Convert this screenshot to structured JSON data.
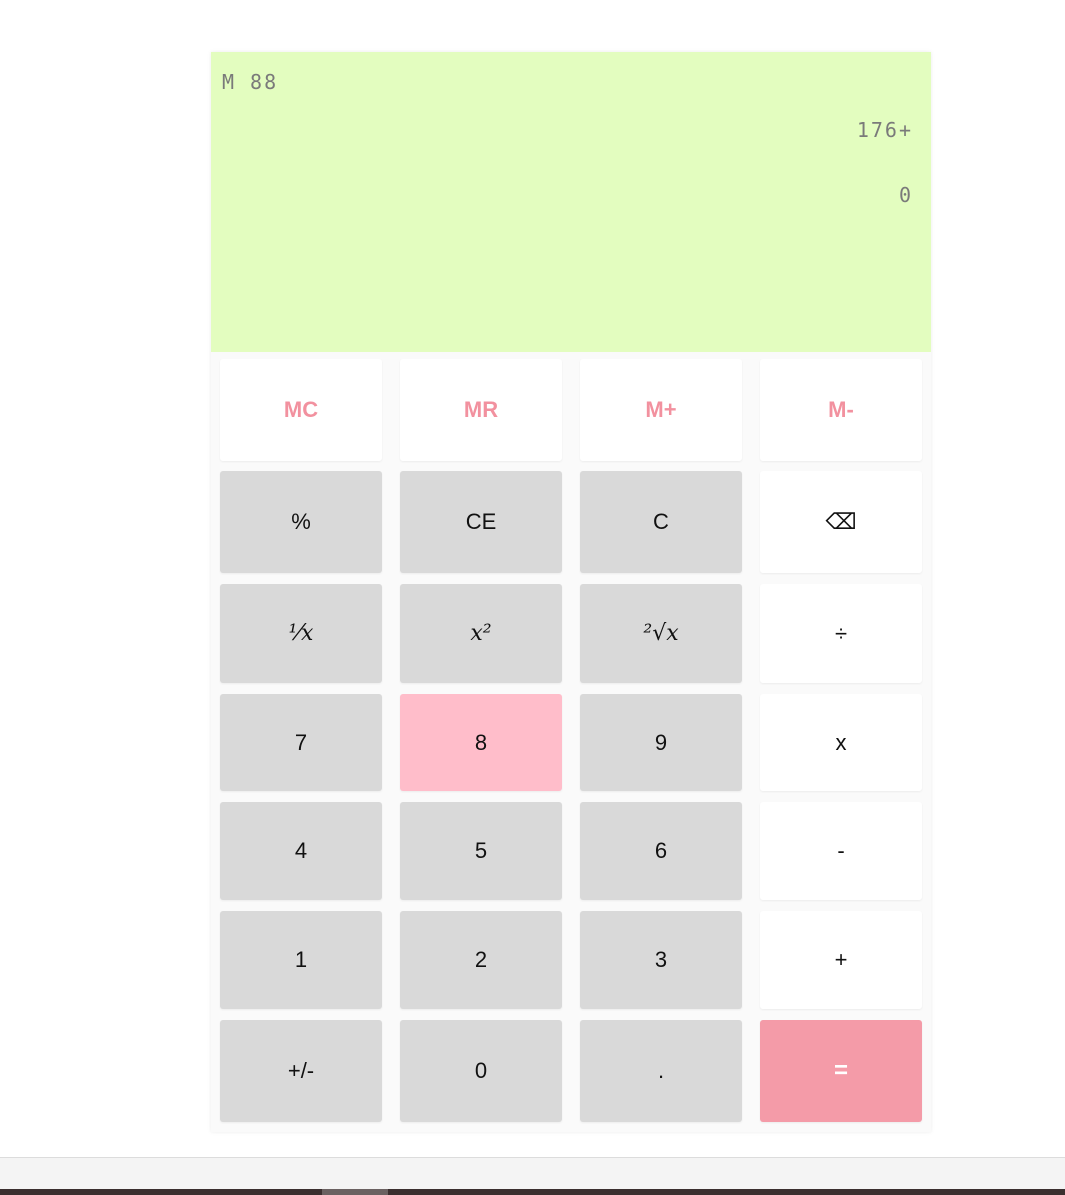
{
  "display": {
    "memory_label": "M",
    "memory_value": "88",
    "expression": "176+",
    "result": "0"
  },
  "keys": {
    "memory": [
      "MC",
      "MR",
      "M+",
      "M-"
    ],
    "row1": [
      "%",
      "CE",
      "C",
      "⌫"
    ],
    "row2": [
      "⅟x",
      "x²",
      "²√x",
      "÷"
    ],
    "row3": [
      "7",
      "8",
      "9",
      "x"
    ],
    "row4": [
      "4",
      "5",
      "6",
      "-"
    ],
    "row5": [
      "1",
      "2",
      "3",
      "+"
    ],
    "row6": [
      "+/-",
      "0",
      ".",
      "="
    ]
  },
  "colors": {
    "display_bg": "#e3fdbf",
    "display_text": "#7a7a7a",
    "digit_key_bg": "#d9d9d9",
    "operator_key_bg": "#ffffff",
    "highlighted_key_bg": "#ffbdca",
    "memory_text": "#f2919f",
    "equals_bg": "#f49ba8"
  },
  "state": {
    "highlighted_key": "8"
  }
}
